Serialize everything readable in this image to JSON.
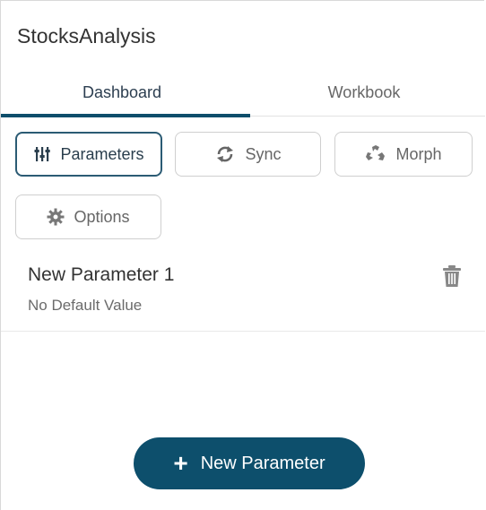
{
  "app": {
    "title": "StocksAnalysis"
  },
  "tabs": [
    {
      "label": "Dashboard",
      "active": true
    },
    {
      "label": "Workbook",
      "active": false
    }
  ],
  "toolbar": {
    "parameters_label": "Parameters",
    "sync_label": "Sync",
    "morph_label": "Morph",
    "options_label": "Options",
    "active": "Parameters"
  },
  "parameters": [
    {
      "name": "New Parameter 1",
      "default": "No Default Value"
    }
  ],
  "actions": {
    "new_parameter_label": "New Parameter"
  },
  "icons": {
    "parameters": "sliders-icon",
    "sync": "sync-icon",
    "morph": "recycle-icon",
    "options": "gear-icon",
    "delete": "trash-icon",
    "add": "plus-icon"
  },
  "colors": {
    "accent": "#0d4f6c",
    "active_border": "#2b5b74"
  }
}
